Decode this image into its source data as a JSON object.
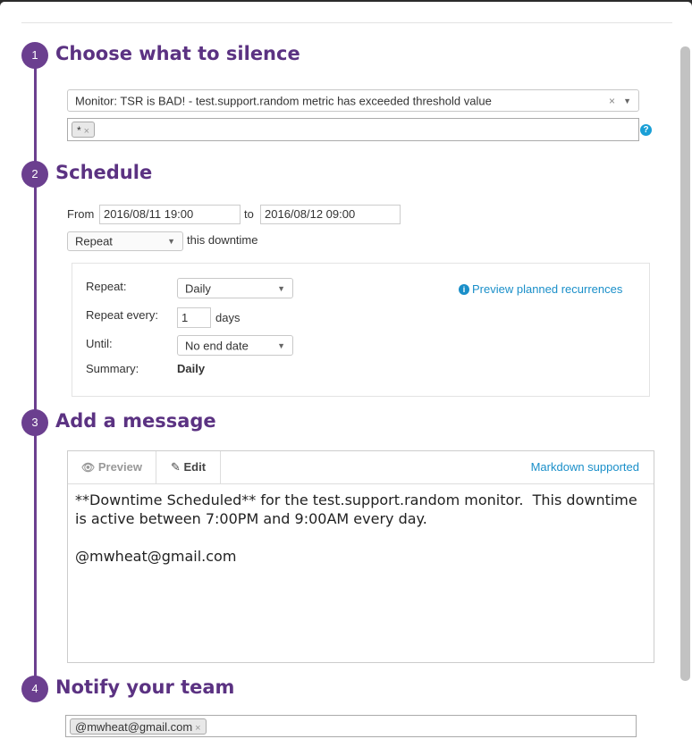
{
  "steps": [
    {
      "num": "1",
      "title": "Choose what to silence"
    },
    {
      "num": "2",
      "title": "Schedule"
    },
    {
      "num": "3",
      "title": "Add a message"
    },
    {
      "num": "4",
      "title": "Notify your team"
    }
  ],
  "silence": {
    "monitor_value": "Monitor: TSR is BAD! - test.support.random metric has exceeded threshold value",
    "scope_tags": [
      "*"
    ],
    "help_glyph": "?"
  },
  "schedule": {
    "from_label": "From",
    "from_value": "2016/08/11 19:00",
    "to_label": "to",
    "to_value": "2016/08/12 09:00",
    "mode_value": "Repeat",
    "mode_suffix": "this downtime",
    "repeat": {
      "repeat_label": "Repeat:",
      "repeat_value": "Daily",
      "every_label": "Repeat every:",
      "every_value": "1",
      "every_unit": "days",
      "until_label": "Until:",
      "until_value": "No end date",
      "summary_label": "Summary:",
      "summary_value": "Daily",
      "preview_link": "Preview planned recurrences"
    }
  },
  "message": {
    "tab_preview": "Preview",
    "tab_edit": "Edit",
    "markdown_link": "Markdown supported",
    "body": "**Downtime Scheduled** for the test.support.random monitor.  This downtime is active between 7:00PM and 9:00AM every day.\n\n@mwheat@gmail.com"
  },
  "notify": {
    "recipients": [
      "@mwheat@gmail.com"
    ]
  },
  "colors": {
    "accent_purple": "#6b3f8f",
    "title_purple": "#5b3282",
    "link_blue": "#1a8fc9"
  }
}
